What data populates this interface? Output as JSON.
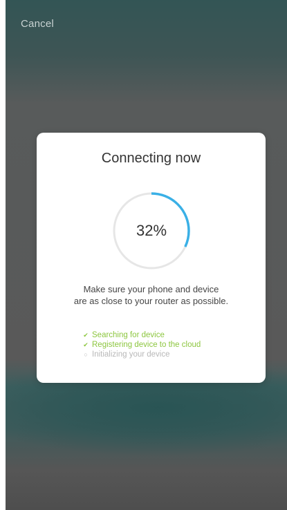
{
  "header": {
    "cancel_label": "Cancel"
  },
  "dialog": {
    "title": "Connecting now",
    "progress": {
      "percent": 32,
      "label": "32%",
      "track_color": "#e6e6e6",
      "fill_color": "#3ab0e6"
    },
    "hint_line1": "Make sure your phone and device",
    "hint_line2": "are as close to your router as possible.",
    "steps": [
      {
        "label": "Searching for device",
        "status": "done",
        "icon": "check-icon"
      },
      {
        "label": "Registering device to the cloud",
        "status": "done",
        "icon": "check-icon"
      },
      {
        "label": "Initializing your device",
        "status": "pending",
        "icon": "circle-icon"
      }
    ]
  },
  "colors": {
    "done": "#8cc63e",
    "pending": "#b8b8b8"
  }
}
